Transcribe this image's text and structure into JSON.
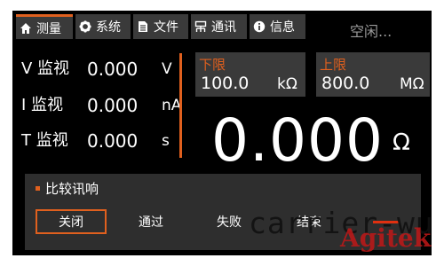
{
  "tabs": [
    {
      "label": "测量",
      "icon": "home-icon",
      "active": true
    },
    {
      "label": "系统",
      "icon": "gear-icon",
      "active": false
    },
    {
      "label": "文件",
      "icon": "file-icon",
      "active": false
    },
    {
      "label": "通讯",
      "icon": "network-icon",
      "active": false
    },
    {
      "label": "信息",
      "icon": "info-icon",
      "active": false
    }
  ],
  "status": "空闲...",
  "readouts": [
    {
      "label": "V 监视",
      "value": "0.000",
      "unit": "V"
    },
    {
      "label": "I 监视",
      "value": "0.000",
      "unit": "nA"
    },
    {
      "label": "T 监视",
      "value": "0.000",
      "unit": "s"
    }
  ],
  "lower_limit": {
    "title": "下限",
    "value": "100.0",
    "unit": "kΩ"
  },
  "upper_limit": {
    "title": "上限",
    "value": "800.0",
    "unit": "MΩ"
  },
  "measurement": {
    "value": "0.000",
    "unit": "Ω"
  },
  "compare": {
    "title": "比较讯响",
    "options": [
      "关闭",
      "通过",
      "失败",
      "结束"
    ],
    "selected": "关闭"
  },
  "watermark": {
    "text": "carrier-wu",
    "brand": "Agitek"
  },
  "colors": {
    "accent": "#e0601e",
    "screen_bg": "#000000",
    "tab_bg": "#3a3a3a",
    "panel_bg": "#2e2e2e"
  }
}
